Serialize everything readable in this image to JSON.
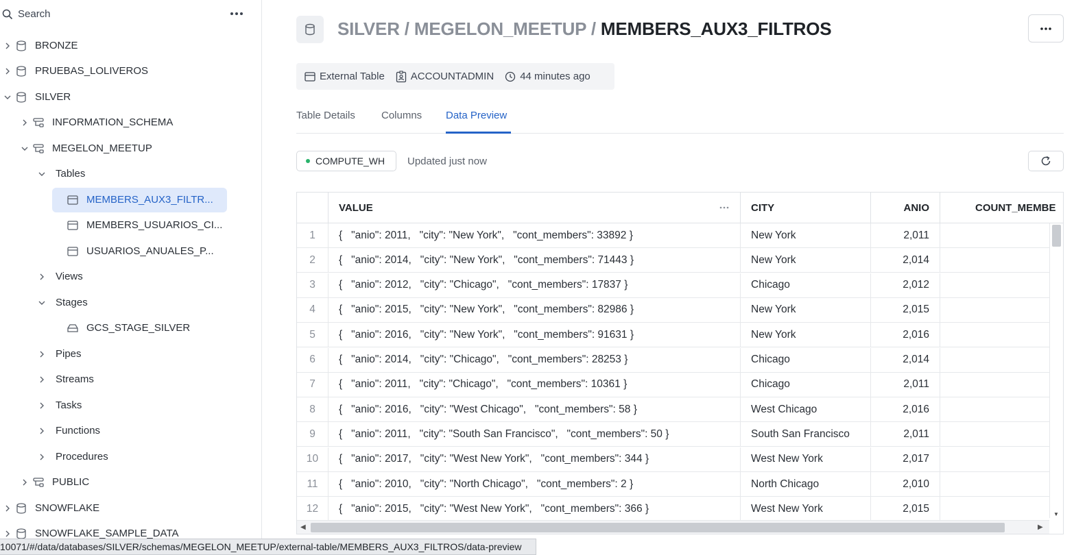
{
  "sidebar": {
    "search_label": "Search",
    "tree": [
      {
        "label": "BRONZE",
        "icon": "database-icon",
        "state": "collapsed"
      },
      {
        "label": "PRUEBAS_LOLIVEROS",
        "icon": "database-icon",
        "state": "collapsed"
      },
      {
        "label": "SILVER",
        "icon": "database-icon",
        "state": "expanded"
      },
      {
        "label": "INFORMATION_SCHEMA",
        "icon": "schema-icon",
        "state": "collapsed"
      },
      {
        "label": "MEGELON_MEETUP",
        "icon": "schema-icon",
        "state": "expanded"
      },
      {
        "label": "Tables",
        "icon": "",
        "state": "expanded"
      },
      {
        "label": "MEMBERS_AUX3_FILTR...",
        "icon": "table-icon",
        "state": "selected"
      },
      {
        "label": "MEMBERS_USUARIOS_CI...",
        "icon": "table-icon",
        "state": "leaf"
      },
      {
        "label": "USUARIOS_ANUALES_P...",
        "icon": "table-icon",
        "state": "leaf"
      },
      {
        "label": "Views",
        "icon": "",
        "state": "collapsed"
      },
      {
        "label": "Stages",
        "icon": "",
        "state": "expanded"
      },
      {
        "label": "GCS_STAGE_SILVER",
        "icon": "stage-icon",
        "state": "leaf"
      },
      {
        "label": "Pipes",
        "icon": "",
        "state": "collapsed"
      },
      {
        "label": "Streams",
        "icon": "",
        "state": "collapsed"
      },
      {
        "label": "Tasks",
        "icon": "",
        "state": "collapsed"
      },
      {
        "label": "Functions",
        "icon": "",
        "state": "collapsed"
      },
      {
        "label": "Procedures",
        "icon": "",
        "state": "collapsed"
      },
      {
        "label": "PUBLIC",
        "icon": "schema-icon",
        "state": "collapsed"
      },
      {
        "label": "SNOWFLAKE",
        "icon": "database-icon",
        "state": "collapsed"
      },
      {
        "label": "SNOWFLAKE_SAMPLE_DATA",
        "icon": "database-icon",
        "state": "collapsed"
      }
    ]
  },
  "header": {
    "crumb_db": "SILVER",
    "crumb_sep1": " / ",
    "crumb_schema": "MEGELON_MEETUP",
    "crumb_sep2": " / ",
    "crumb_table": "MEMBERS_AUX3_FILTROS"
  },
  "meta": {
    "type_label": "External Table",
    "owner_label": "ACCOUNTADMIN",
    "time_label": "44 minutes ago"
  },
  "tabs": [
    {
      "label": "Table Details",
      "active": false
    },
    {
      "label": "Columns",
      "active": false
    },
    {
      "label": "Data Preview",
      "active": true
    }
  ],
  "toolbar": {
    "warehouse": "COMPUTE_WH",
    "updated": "Updated just now",
    "accent_color": "#2563c7",
    "status_color": "#29b36b"
  },
  "grid": {
    "columns": [
      "VALUE",
      "CITY",
      "ANIO",
      "COUNT_MEMBE"
    ],
    "rows": [
      {
        "n": "1",
        "value": "{   \"anio\": 2011,   \"city\": \"New York\",   \"cont_members\": 33892 }",
        "city": "New York",
        "anio": "2,011"
      },
      {
        "n": "2",
        "value": "{   \"anio\": 2014,   \"city\": \"New York\",   \"cont_members\": 71443 }",
        "city": "New York",
        "anio": "2,014"
      },
      {
        "n": "3",
        "value": "{   \"anio\": 2012,   \"city\": \"Chicago\",   \"cont_members\": 17837 }",
        "city": "Chicago",
        "anio": "2,012"
      },
      {
        "n": "4",
        "value": "{   \"anio\": 2015,   \"city\": \"New York\",   \"cont_members\": 82986 }",
        "city": "New York",
        "anio": "2,015"
      },
      {
        "n": "5",
        "value": "{   \"anio\": 2016,   \"city\": \"New York\",   \"cont_members\": 91631 }",
        "city": "New York",
        "anio": "2,016"
      },
      {
        "n": "6",
        "value": "{   \"anio\": 2014,   \"city\": \"Chicago\",   \"cont_members\": 28253 }",
        "city": "Chicago",
        "anio": "2,014"
      },
      {
        "n": "7",
        "value": "{   \"anio\": 2011,   \"city\": \"Chicago\",   \"cont_members\": 10361 }",
        "city": "Chicago",
        "anio": "2,011"
      },
      {
        "n": "8",
        "value": "{   \"anio\": 2016,   \"city\": \"West Chicago\",   \"cont_members\": 58 }",
        "city": "West Chicago",
        "anio": "2,016"
      },
      {
        "n": "9",
        "value": "{   \"anio\": 2011,   \"city\": \"South San Francisco\",   \"cont_members\": 50 }",
        "city": "South San Francisco",
        "anio": "2,011"
      },
      {
        "n": "10",
        "value": "{   \"anio\": 2017,   \"city\": \"West New York\",   \"cont_members\": 344 }",
        "city": "West New York",
        "anio": "2,017"
      },
      {
        "n": "11",
        "value": "{   \"anio\": 2010,   \"city\": \"North Chicago\",   \"cont_members\": 2 }",
        "city": "North Chicago",
        "anio": "2,010"
      },
      {
        "n": "12",
        "value": "{   \"anio\": 2015,   \"city\": \"West New York\",   \"cont_members\": 366 }",
        "city": "West New York",
        "anio": "2,015"
      }
    ]
  },
  "status_url": "10071/#/data/databases/SILVER/schemas/MEGELON_MEETUP/external-table/MEMBERS_AUX3_FILTROS/data-preview"
}
